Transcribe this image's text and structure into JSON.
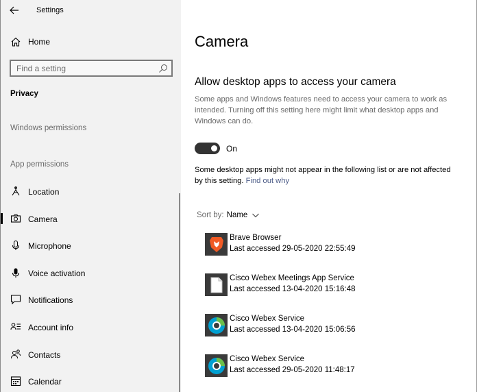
{
  "window": {
    "title": "Settings"
  },
  "sidebar": {
    "home_label": "Home",
    "search_placeholder": "Find a setting",
    "section_privacy": "Privacy",
    "heading_windows_permissions": "Windows permissions",
    "heading_app_permissions": "App permissions",
    "items": [
      {
        "label": "Location",
        "icon": "location-icon"
      },
      {
        "label": "Camera",
        "icon": "camera-icon",
        "selected": true
      },
      {
        "label": "Microphone",
        "icon": "microphone-icon"
      },
      {
        "label": "Voice activation",
        "icon": "voice-activation-icon"
      },
      {
        "label": "Notifications",
        "icon": "notifications-icon"
      },
      {
        "label": "Account info",
        "icon": "account-info-icon"
      },
      {
        "label": "Contacts",
        "icon": "contacts-icon"
      },
      {
        "label": "Calendar",
        "icon": "calendar-icon"
      }
    ]
  },
  "main": {
    "page_title": "Camera",
    "section_title": "Allow desktop apps to access your camera",
    "description": "Some apps and Windows features need to access your camera to work as intended. Turning off this setting here might limit what desktop apps and Windows can do.",
    "toggle": {
      "state": "On",
      "on": true
    },
    "note_text": "Some desktop apps might not appear in the following list or are not affected by this setting.",
    "note_link": "Find out why",
    "sort": {
      "label": "Sort by:",
      "value": "Name"
    },
    "apps": [
      {
        "name": "Brave Browser",
        "accessed": "Last accessed 29-05-2020 22:55:49",
        "icon": "brave-icon"
      },
      {
        "name": "Cisco Webex Meetings App Service",
        "accessed": "Last accessed 13-04-2020 15:16:48",
        "icon": "generic-file-icon"
      },
      {
        "name": "Cisco Webex Service",
        "accessed": "Last accessed 13-04-2020 15:06:56",
        "icon": "webex-icon"
      },
      {
        "name": "Cisco Webex Service",
        "accessed": "Last accessed 29-05-2020 11:48:17",
        "icon": "webex-icon"
      }
    ]
  },
  "colors": {
    "sidebar_bg": "#f2f2f2",
    "toggle_on": "#333333",
    "link": "#4b5b87",
    "brave": "#f15a24",
    "webex_blue": "#00a0d1",
    "webex_green": "#6cc04a"
  }
}
